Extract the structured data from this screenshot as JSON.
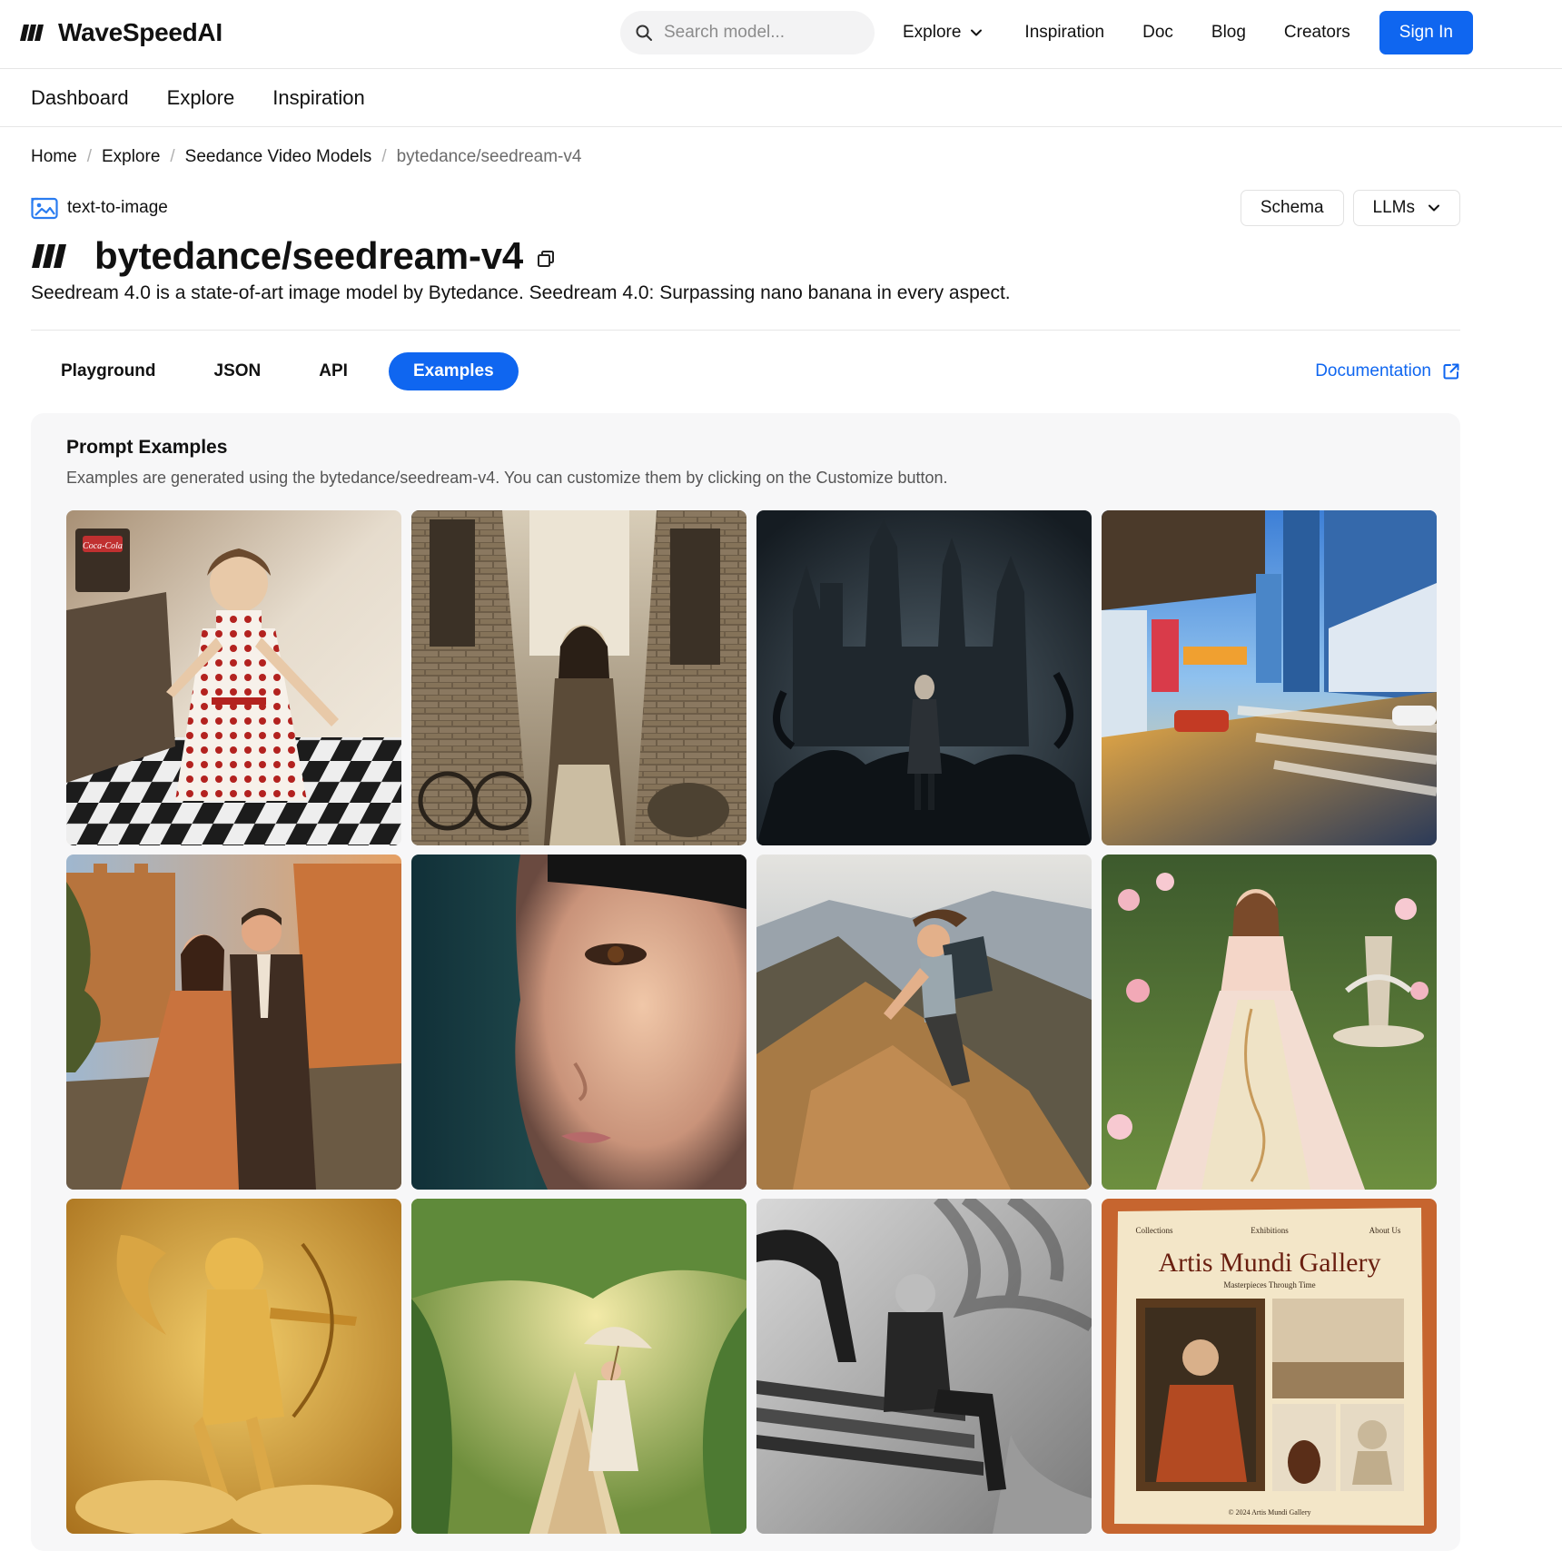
{
  "brand": {
    "name": "WaveSpeedAI",
    "accent": "#0f66f0"
  },
  "topnav": {
    "search_placeholder": "Search model...",
    "links": [
      "Explore",
      "Inspiration",
      "Doc",
      "Blog",
      "Creators"
    ],
    "sign_in": "Sign In"
  },
  "subnav": {
    "items": [
      "Dashboard",
      "Explore",
      "Inspiration"
    ]
  },
  "breadcrumb": [
    "Home",
    "Explore",
    "Seedance Video Models",
    "bytedance/seedream-v4"
  ],
  "model": {
    "category": "text-to-image",
    "title": "bytedance/seedream-v4",
    "description": "Seedream 4.0 is a state-of-art image model by Bytedance. Seedream 4.0: Surpassing nano banana in every aspect."
  },
  "actions": {
    "schema": "Schema",
    "llms": "LLMs"
  },
  "tabs": {
    "items": [
      "Playground",
      "JSON",
      "API",
      "Examples"
    ],
    "active": "Examples"
  },
  "documentation": "Documentation",
  "examples": {
    "title": "Prompt Examples",
    "subtitle": "Examples are generated using the bytedance/seedream-v4. You can customize them by clicking on the Customize button.",
    "gallery_card": {
      "nav": [
        "Collections",
        "Exhibitions",
        "About Us"
      ],
      "title": "Artis Mundi Gallery",
      "tagline": "Masterpieces Through Time",
      "footer": "© 2024 Artis Mundi Gallery"
    },
    "diner_sign": "Coca-Cola"
  }
}
